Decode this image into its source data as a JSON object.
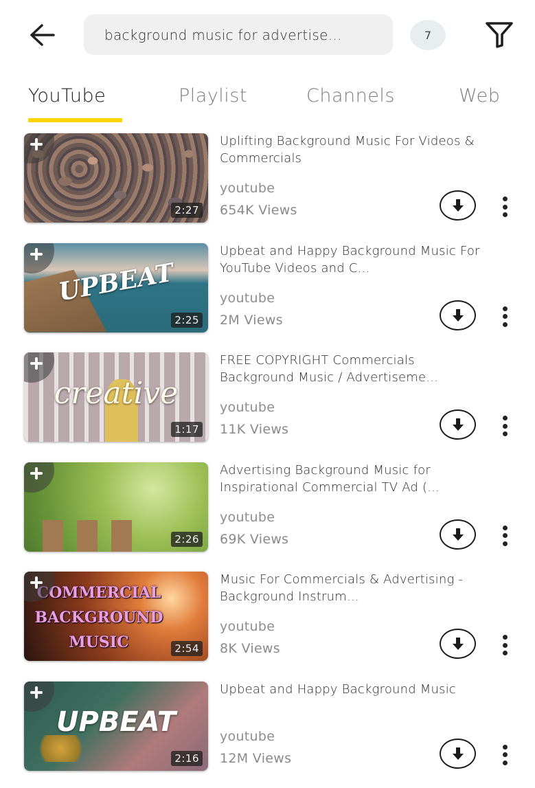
{
  "header": {
    "back_icon": "arrow-left-icon",
    "search_query": "background music for advertise...",
    "result_badge": "7",
    "filter_icon": "filter-funnel-icon"
  },
  "tabs": [
    {
      "label": "YouTube",
      "active": true
    },
    {
      "label": "Playlist",
      "active": false
    },
    {
      "label": "Channels",
      "active": false
    },
    {
      "label": "Web",
      "active": false
    }
  ],
  "colors": {
    "tab_indicator": "#ffd500",
    "search_bg": "#f0f0f0",
    "badge_bg": "#e8eeef"
  },
  "results": [
    {
      "title": "Uplifting Background Music For Videos & Commercials",
      "source": "youtube",
      "views": "654K Views",
      "duration": "2:27",
      "thumb_text": ""
    },
    {
      "title": "Upbeat and Happy Background Music For YouTube Videos and C...",
      "source": "youtube",
      "views": "2M Views",
      "duration": "2:25",
      "thumb_text": "UPBEAT"
    },
    {
      "title": "FREE COPYRIGHT Commercials Background Music / Advertiseme...",
      "source": "youtube",
      "views": "11K Views",
      "duration": "1:17",
      "thumb_text": "creative"
    },
    {
      "title": "Advertising Background Music for Inspirational Commercial TV Ad (...",
      "source": "youtube",
      "views": "69K Views",
      "duration": "2:26",
      "thumb_text": ""
    },
    {
      "title": "Music For Commercials & Advertising - Background Instrum...",
      "source": "youtube",
      "views": "8K Views",
      "duration": "2:54",
      "thumb_text": "COMMERCIAL BACKGROUND MUSIC"
    },
    {
      "title": "Upbeat and Happy Background Music",
      "source": "youtube",
      "views": "12M Views",
      "duration": "2:16",
      "thumb_text": "UPBEAT"
    }
  ],
  "item_actions": {
    "add_icon": "plus-icon",
    "download_icon": "download-arrow-icon",
    "more_icon": "more-vertical-icon"
  }
}
